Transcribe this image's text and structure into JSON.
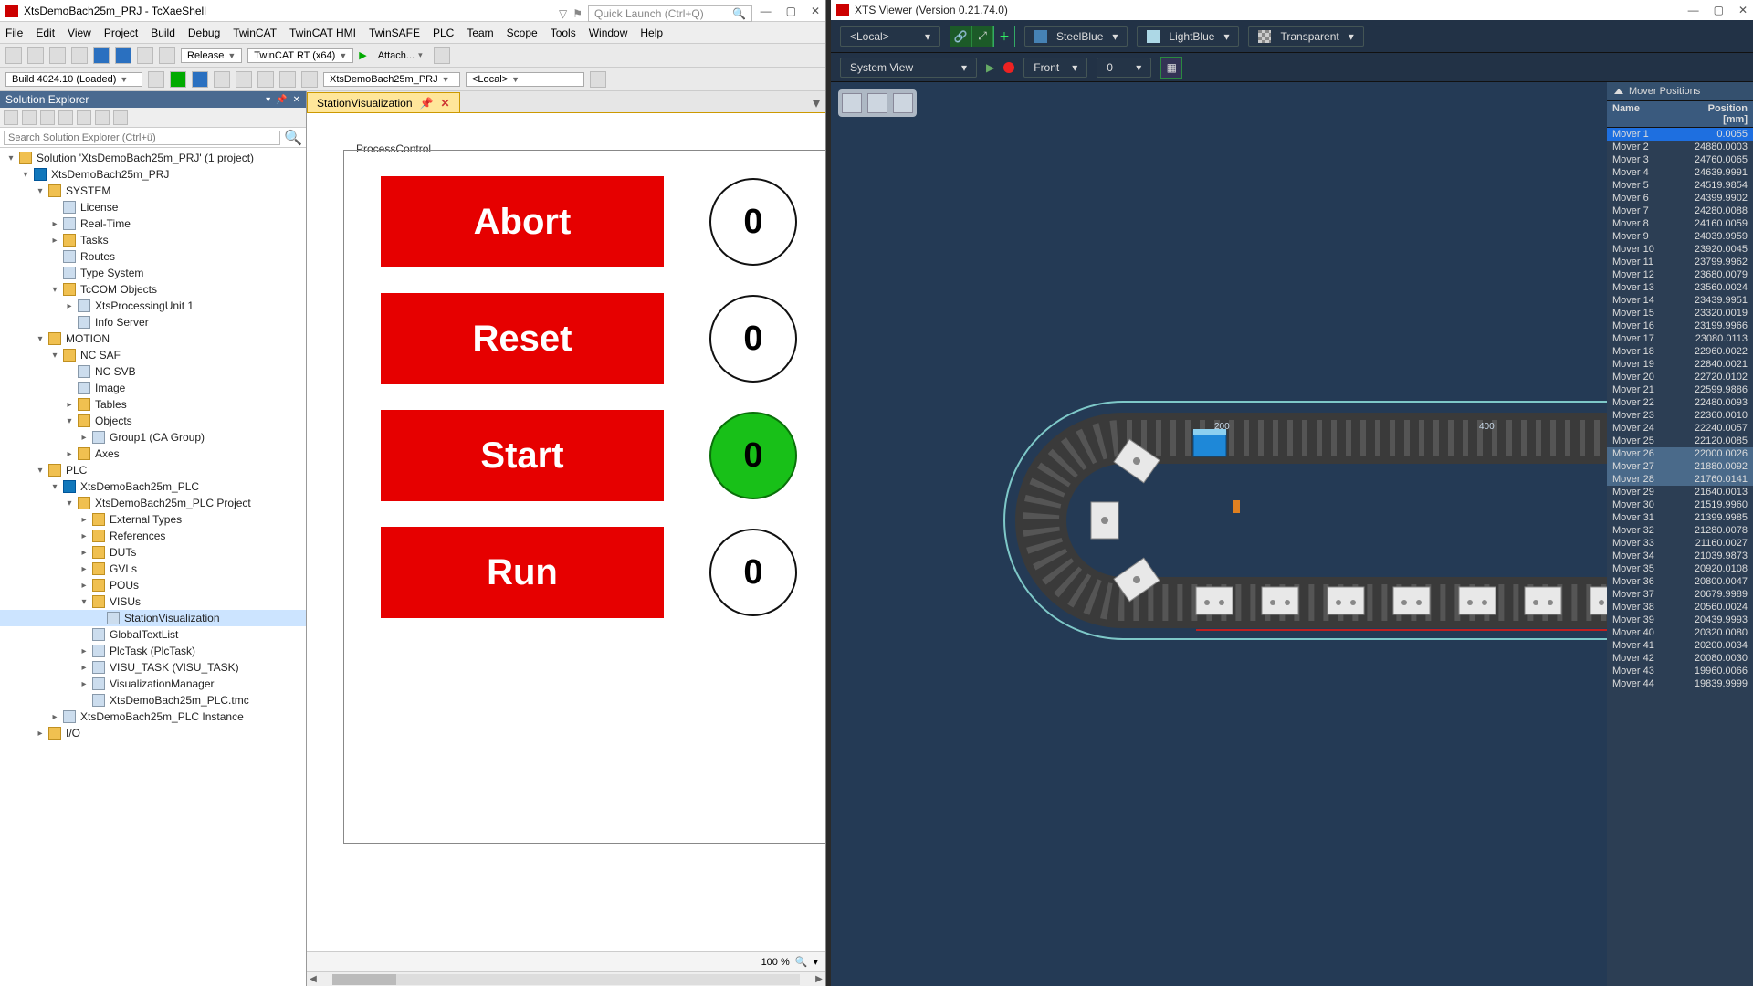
{
  "ide": {
    "title": "XtsDemoBach25m_PRJ - TcXaeShell",
    "quick_launch_placeholder": "Quick Launch (Ctrl+Q)",
    "menu": [
      "File",
      "Edit",
      "View",
      "Project",
      "Build",
      "Debug",
      "TwinCAT",
      "TwinCAT HMI",
      "TwinSAFE",
      "PLC",
      "Team",
      "Scope",
      "Tools",
      "Window",
      "Help"
    ],
    "toolbar1": {
      "release": "Release",
      "target": "TwinCAT RT (x64)",
      "attach": "Attach...",
      "build_combo": "Build 4024.10 (Loaded)",
      "project_combo": "XtsDemoBach25m_PRJ",
      "local_combo": "<Local>"
    },
    "solution_explorer": {
      "title": "Solution Explorer",
      "search_placeholder": "Search Solution Explorer (Ctrl+ü)",
      "tree": [
        {
          "d": 0,
          "e": "-",
          "ic": "fold",
          "t": "Solution 'XtsDemoBach25m_PRJ' (1 project)"
        },
        {
          "d": 1,
          "e": "-",
          "ic": "plc",
          "t": "XtsDemoBach25m_PRJ"
        },
        {
          "d": 2,
          "e": "-",
          "ic": "fold",
          "t": "SYSTEM"
        },
        {
          "d": 3,
          "e": "",
          "ic": "file",
          "t": "License"
        },
        {
          "d": 3,
          "e": "+",
          "ic": "file",
          "t": "Real-Time"
        },
        {
          "d": 3,
          "e": "+",
          "ic": "fold",
          "t": "Tasks"
        },
        {
          "d": 3,
          "e": "",
          "ic": "file",
          "t": "Routes"
        },
        {
          "d": 3,
          "e": "",
          "ic": "file",
          "t": "Type System"
        },
        {
          "d": 3,
          "e": "-",
          "ic": "fold",
          "t": "TcCOM Objects"
        },
        {
          "d": 4,
          "e": "+",
          "ic": "file",
          "t": "XtsProcessingUnit 1"
        },
        {
          "d": 4,
          "e": "",
          "ic": "file",
          "t": "Info Server"
        },
        {
          "d": 2,
          "e": "-",
          "ic": "fold",
          "t": "MOTION"
        },
        {
          "d": 3,
          "e": "-",
          "ic": "fold",
          "t": "NC SAF"
        },
        {
          "d": 4,
          "e": "",
          "ic": "file",
          "t": "NC SVB"
        },
        {
          "d": 4,
          "e": "",
          "ic": "file",
          "t": "Image"
        },
        {
          "d": 4,
          "e": "+",
          "ic": "fold",
          "t": "Tables"
        },
        {
          "d": 4,
          "e": "-",
          "ic": "fold",
          "t": "Objects"
        },
        {
          "d": 5,
          "e": "+",
          "ic": "file",
          "t": "Group1 (CA Group)"
        },
        {
          "d": 4,
          "e": "+",
          "ic": "fold",
          "t": "Axes"
        },
        {
          "d": 2,
          "e": "-",
          "ic": "fold",
          "t": "PLC"
        },
        {
          "d": 3,
          "e": "-",
          "ic": "plc",
          "t": "XtsDemoBach25m_PLC"
        },
        {
          "d": 4,
          "e": "-",
          "ic": "fold",
          "t": "XtsDemoBach25m_PLC Project"
        },
        {
          "d": 5,
          "e": "+",
          "ic": "fold",
          "t": "External Types"
        },
        {
          "d": 5,
          "e": "+",
          "ic": "fold",
          "t": "References"
        },
        {
          "d": 5,
          "e": "+",
          "ic": "fold",
          "t": "DUTs"
        },
        {
          "d": 5,
          "e": "+",
          "ic": "fold",
          "t": "GVLs"
        },
        {
          "d": 5,
          "e": "+",
          "ic": "fold",
          "t": "POUs"
        },
        {
          "d": 5,
          "e": "-",
          "ic": "fold",
          "t": "VISUs"
        },
        {
          "d": 6,
          "e": "",
          "ic": "file",
          "t": "StationVisualization",
          "sel": true
        },
        {
          "d": 5,
          "e": "",
          "ic": "file",
          "t": "GlobalTextList"
        },
        {
          "d": 5,
          "e": "+",
          "ic": "file",
          "t": "PlcTask (PlcTask)"
        },
        {
          "d": 5,
          "e": "+",
          "ic": "file",
          "t": "VISU_TASK (VISU_TASK)"
        },
        {
          "d": 5,
          "e": "+",
          "ic": "file",
          "t": "VisualizationManager"
        },
        {
          "d": 5,
          "e": "",
          "ic": "file",
          "t": "XtsDemoBach25m_PLC.tmc"
        },
        {
          "d": 3,
          "e": "+",
          "ic": "file",
          "t": "XtsDemoBach25m_PLC Instance"
        },
        {
          "d": 2,
          "e": "+",
          "ic": "fold",
          "t": "I/O"
        }
      ]
    },
    "editor": {
      "tab": "StationVisualization",
      "group_label": "ProcessControl",
      "buttons": [
        {
          "label": "Abort",
          "val": "0",
          "green": false
        },
        {
          "label": "Reset",
          "val": "0",
          "green": false
        },
        {
          "label": "Start",
          "val": "0",
          "green": true
        },
        {
          "label": "Run",
          "val": "0",
          "green": false
        }
      ],
      "zoom": "100 %"
    }
  },
  "xts": {
    "title": "XTS Viewer (Version 0.21.74.0)",
    "local": "<Local>",
    "color1": "SteelBlue",
    "color2": "LightBlue",
    "color3": "Transparent",
    "view_label": "System View",
    "front": "Front",
    "front_val": "0",
    "panel_title": "Mover Positions",
    "col1": "Name",
    "col2": "Position [mm]",
    "movers": [
      {
        "n": "Mover 1",
        "p": "0.0055",
        "sel": true
      },
      {
        "n": "Mover 2",
        "p": "24880.0003"
      },
      {
        "n": "Mover 3",
        "p": "24760.0065"
      },
      {
        "n": "Mover 4",
        "p": "24639.9991"
      },
      {
        "n": "Mover 5",
        "p": "24519.9854"
      },
      {
        "n": "Mover 6",
        "p": "24399.9902"
      },
      {
        "n": "Mover 7",
        "p": "24280.0088"
      },
      {
        "n": "Mover 8",
        "p": "24160.0059"
      },
      {
        "n": "Mover 9",
        "p": "24039.9959"
      },
      {
        "n": "Mover 10",
        "p": "23920.0045"
      },
      {
        "n": "Mover 11",
        "p": "23799.9962"
      },
      {
        "n": "Mover 12",
        "p": "23680.0079"
      },
      {
        "n": "Mover 13",
        "p": "23560.0024"
      },
      {
        "n": "Mover 14",
        "p": "23439.9951"
      },
      {
        "n": "Mover 15",
        "p": "23320.0019"
      },
      {
        "n": "Mover 16",
        "p": "23199.9966"
      },
      {
        "n": "Mover 17",
        "p": "23080.0113"
      },
      {
        "n": "Mover 18",
        "p": "22960.0022"
      },
      {
        "n": "Mover 19",
        "p": "22840.0021"
      },
      {
        "n": "Mover 20",
        "p": "22720.0102"
      },
      {
        "n": "Mover 21",
        "p": "22599.9886"
      },
      {
        "n": "Mover 22",
        "p": "22480.0093"
      },
      {
        "n": "Mover 23",
        "p": "22360.0010"
      },
      {
        "n": "Mover 24",
        "p": "22240.0057"
      },
      {
        "n": "Mover 25",
        "p": "22120.0085"
      },
      {
        "n": "Mover 26",
        "p": "22000.0026",
        "hi": true
      },
      {
        "n": "Mover 27",
        "p": "21880.0092",
        "hi": true
      },
      {
        "n": "Mover 28",
        "p": "21760.0141",
        "hi": true
      },
      {
        "n": "Mover 29",
        "p": "21640.0013"
      },
      {
        "n": "Mover 30",
        "p": "21519.9960"
      },
      {
        "n": "Mover 31",
        "p": "21399.9985"
      },
      {
        "n": "Mover 32",
        "p": "21280.0078"
      },
      {
        "n": "Mover 33",
        "p": "21160.0027"
      },
      {
        "n": "Mover 34",
        "p": "21039.9873"
      },
      {
        "n": "Mover 35",
        "p": "20920.0108"
      },
      {
        "n": "Mover 36",
        "p": "20800.0047"
      },
      {
        "n": "Mover 37",
        "p": "20679.9989"
      },
      {
        "n": "Mover 38",
        "p": "20560.0024"
      },
      {
        "n": "Mover 39",
        "p": "20439.9993"
      },
      {
        "n": "Mover 40",
        "p": "20320.0080"
      },
      {
        "n": "Mover 41",
        "p": "20200.0034"
      },
      {
        "n": "Mover 42",
        "p": "20080.0030"
      },
      {
        "n": "Mover 43",
        "p": "19960.0066"
      },
      {
        "n": "Mover 44",
        "p": "19839.9999"
      }
    ]
  }
}
